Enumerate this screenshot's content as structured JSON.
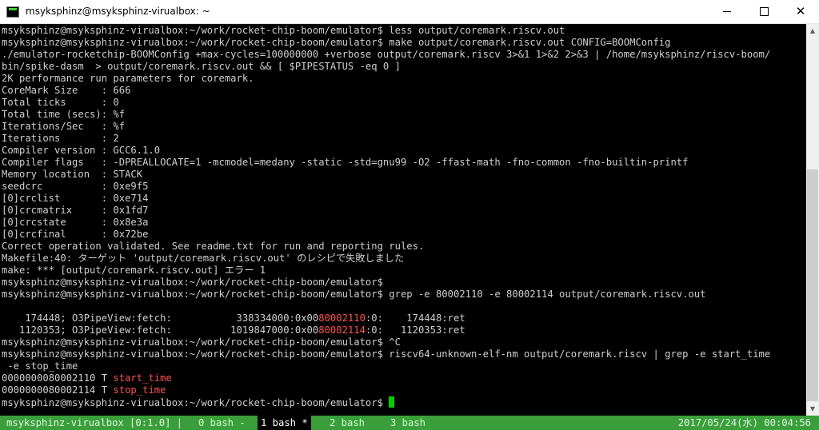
{
  "window": {
    "title": "msyksphinz@msyksphinz-virualbox: ~",
    "controls": {
      "minimize": "minimize",
      "maximize": "maximize",
      "close": "close"
    }
  },
  "terminal": {
    "lines": [
      "msyksphinz@msyksphinz-virualbox:~/work/rocket-chip-boom/emulator$ less output/coremark.riscv.out",
      "msyksphinz@msyksphinz-virualbox:~/work/rocket-chip-boom/emulator$ make output/coremark.riscv.out CONFIG=BOOMConfig",
      "./emulator-rocketchip-BOOMConfig +max-cycles=100000000 +verbose output/coremark.riscv 3>&1 1>&2 2>&3 | /home/msyksphinz/riscv-boom/",
      "bin/spike-dasm  > output/coremark.riscv.out && [ $PIPESTATUS -eq 0 ]",
      "2K performance run parameters for coremark.",
      "CoreMark Size    : 666",
      "Total ticks      : 0",
      "Total time (secs): %f",
      "Iterations/Sec   : %f",
      "Iterations       : 2",
      "Compiler version : GCC6.1.0",
      "Compiler flags   : -DPREALLOCATE=1 -mcmodel=medany -static -std=gnu99 -O2 -ffast-math -fno-common -fno-builtin-printf",
      "Memory location  : STACK",
      "seedcrc          : 0xe9f5",
      "[0]crclist       : 0xe714",
      "[0]crcmatrix     : 0x1fd7",
      "[0]crcstate      : 0x8e3a",
      "[0]crcfinal      : 0x72be",
      "Correct operation validated. See readme.txt for run and reporting rules.",
      "Makefile:40: ターゲット 'output/coremark.riscv.out' のレシピで失敗しました",
      "make: *** [output/coremark.riscv.out] エラー 1",
      "msyksphinz@msyksphinz-virualbox:~/work/rocket-chip-boom/emulator$",
      "msyksphinz@msyksphinz-virualbox:~/work/rocket-chip-boom/emulator$ grep -e 80002110 -e 80002114 output/coremark.riscv.out",
      "",
      "",
      "",
      "msyksphinz@msyksphinz-virualbox:~/work/rocket-chip-boom/emulator$ ^C",
      "msyksphinz@msyksphinz-virualbox:~/work/rocket-chip-boom/emulator$ riscv64-unknown-elf-nm output/coremark.riscv | grep -e start_time",
      " -e stop_time",
      "",
      "",
      "msyksphinz@msyksphinz-virualbox:~/work/rocket-chip-boom/emulator$ "
    ],
    "grep_results": [
      {
        "pre": "    174448; O3PipeView:fetch:           338334000:0x00",
        "hit": "80002110",
        "post": ":0:    174448:ret"
      },
      {
        "pre": "   1120353; O3PipeView:fetch:          1019847000:0x00",
        "hit": "80002114",
        "post": ":0:   1120353:ret"
      }
    ],
    "symbols": [
      {
        "address": "0000000080002110 T ",
        "name": "start_time"
      },
      {
        "address": "0000000080002114 T ",
        "name": "stop_time"
      }
    ]
  },
  "statusbar": {
    "session": "msyksphinz-virualbox [0:1.0] |",
    "tabs": [
      {
        "label": "0 bash -",
        "active": false
      },
      {
        "label": "1 bash *",
        "active": true
      },
      {
        "label": "2 bash",
        "active": false
      },
      {
        "label": "3 bash",
        "active": false
      }
    ],
    "datetime": "2017/05/24(水) 00:04:56"
  },
  "colors": {
    "prompt_text": "#cfcfcf",
    "highlight": "#ff5252",
    "status_bg": "#3a9f3a",
    "cursor": "#00d000"
  }
}
